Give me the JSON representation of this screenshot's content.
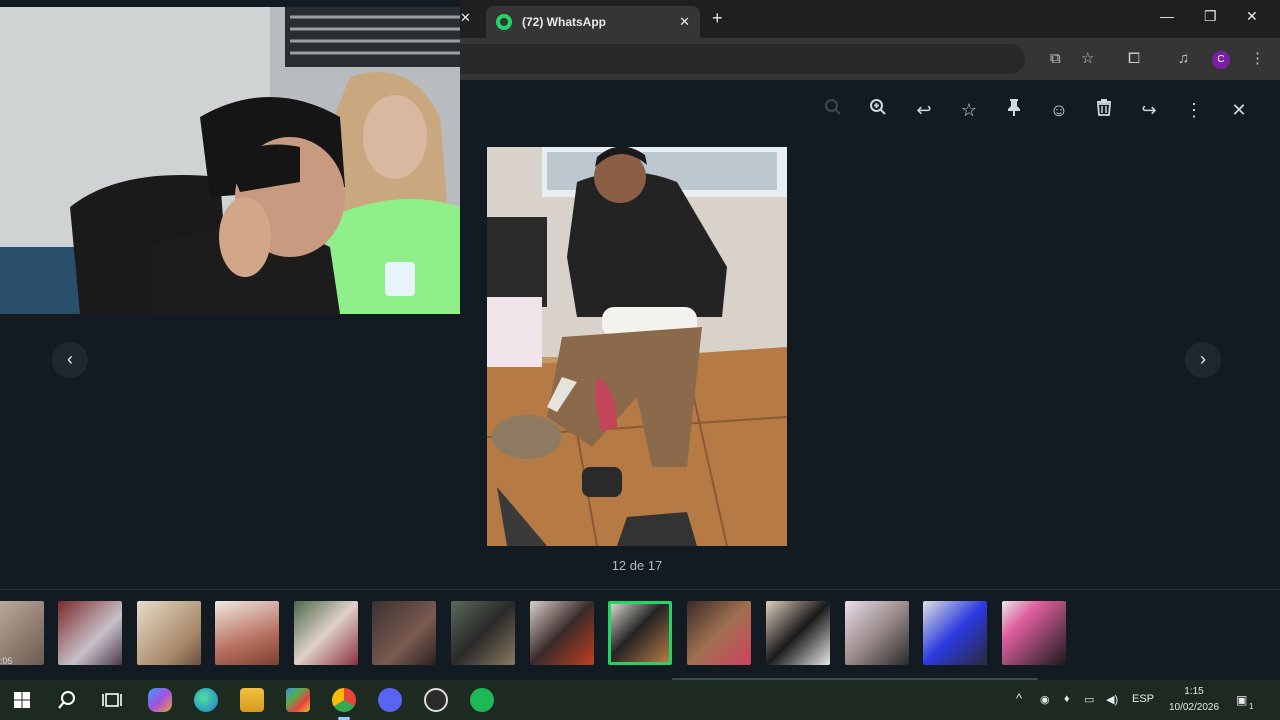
{
  "browser": {
    "tab_title": "(72) WhatsApp",
    "profile_initial": "C"
  },
  "viewer": {
    "counter": "12 de 17",
    "toolbar_icons": [
      "zoom-out-icon",
      "zoom-in-icon",
      "reply-icon",
      "star-icon",
      "pin-icon",
      "emoji-icon",
      "delete-icon",
      "forward-icon",
      "more-icon",
      "close-icon"
    ],
    "thumbnails_count": 14,
    "active_thumbnail_index": 8,
    "first_thumb_timestamp": ":05",
    "accent_color": "#25d366"
  },
  "taskbar": {
    "language": "ESP",
    "time": "1:15",
    "date": "10/02/2026",
    "notification_count": "1"
  }
}
